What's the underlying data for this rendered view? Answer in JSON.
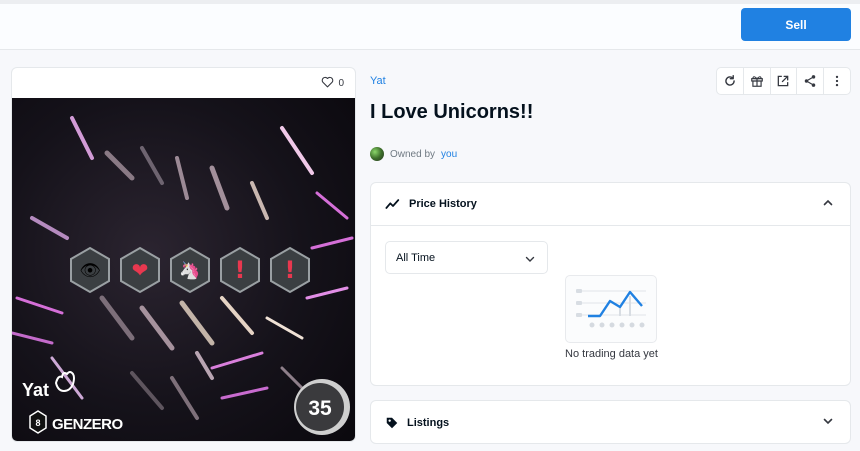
{
  "header": {
    "sell_label": "Sell"
  },
  "card": {
    "favorites_count": "0",
    "art": {
      "logo_text": "Yat",
      "series_badge": "8",
      "series_text": "GENZERO",
      "number": "35",
      "emoji_sequence": [
        "👁",
        "❤",
        "🦄",
        "!",
        "!"
      ]
    }
  },
  "item": {
    "collection": "Yat",
    "title": "I Love Unicorns!!",
    "owned_by_label": "Owned by",
    "owner": "you"
  },
  "price_history": {
    "title": "Price History",
    "range_selected": "All Time",
    "empty_text": "No trading data yet"
  },
  "listings": {
    "title": "Listings"
  },
  "icons": [
    "heart-icon",
    "refresh-icon",
    "gift-icon",
    "external-link-icon",
    "share-icon",
    "more-icon",
    "trend-icon",
    "chevron-up-icon",
    "chevron-down-icon",
    "tag-icon"
  ],
  "colors": {
    "accent": "#2081e2",
    "border": "#e5e8eb",
    "text": "#04111d",
    "muted": "#707a83"
  }
}
